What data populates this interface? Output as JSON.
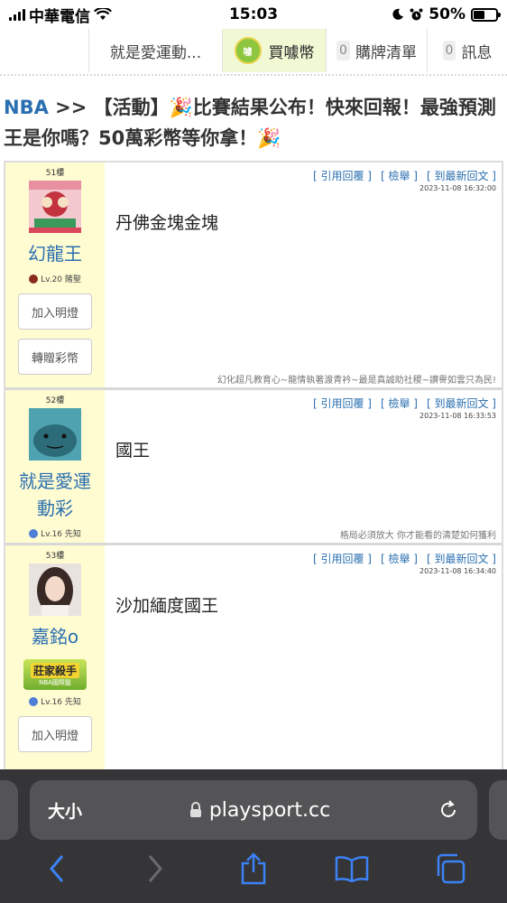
{
  "status_bar": {
    "carrier": "中華電信",
    "time": "15:03",
    "battery": "50%",
    "battery_level": 0.5
  },
  "top_nav": {
    "tabs": [
      {
        "label": "就是愛運動..."
      },
      {
        "label": "買噱幣",
        "icon_text": "噱"
      },
      {
        "count": "0",
        "label": "購牌清單"
      },
      {
        "count": "0",
        "label": "訊息"
      }
    ]
  },
  "thread": {
    "breadcrumb": "NBA",
    "separator": ">>",
    "title_part1": "【活動】",
    "title_part2": "比賽結果公布！快來回報！最強預測王是你嗎？50萬彩幣等你拿！",
    "emoji": "🎉"
  },
  "actions": {
    "quote": "[ 引用回覆 ]",
    "report": "[ 檢舉 ]",
    "latest": "[ 到最新回文 ]"
  },
  "posts": [
    {
      "floor": "51樓",
      "username": "幻龍王",
      "level": "Lv.20 賭聖",
      "time": "2023-11-08 16:32:00",
      "body": "丹佛金塊金塊",
      "signature": "幻化超凡教育心~龍情執著渡青衿~最是真誠助社稷~讃譽如雲只為民!",
      "btn_light": "加入明燈",
      "btn_gift": "轉贈彩幣"
    },
    {
      "floor": "52樓",
      "username": "就是愛運動彩",
      "level": "Lv.16 先知",
      "time": "2023-11-08 16:33:53",
      "body": "國王",
      "signature": "格局必須放大 你才能看的清楚如何獲利"
    },
    {
      "floor": "53樓",
      "username": "嘉銘o",
      "level": "Lv.16 先知",
      "time": "2023-11-08 16:34:40",
      "body": "沙加緬度國王",
      "badge_top": "莊家殺手",
      "badge_bottom": "NBA國際盤",
      "btn_light": "加入明燈"
    }
  ],
  "safari": {
    "aa": "大小",
    "url": "playsport.cc"
  },
  "colors": {
    "link": "#2a6fb0",
    "sidebar_bg": "#fffcd2",
    "active_tab": "#f1f8d4",
    "safari_bg": "#353537"
  }
}
